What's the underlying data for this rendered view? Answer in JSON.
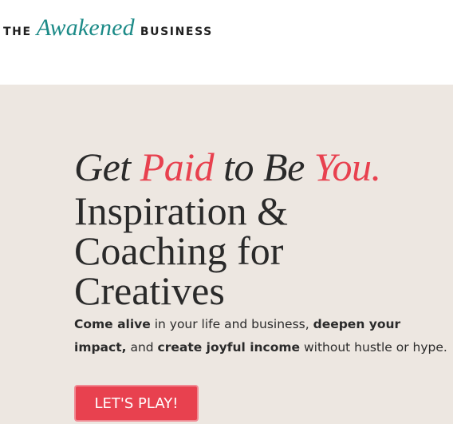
{
  "header": {
    "logo": {
      "the": "THE",
      "awakened": "Awakened",
      "business": "BUSINESS"
    }
  },
  "hero": {
    "headline": {
      "get": "Get",
      "paid": "Paid",
      "to_be": "to Be",
      "you": "You.",
      "rest": "Inspiration & Coaching for Creatives"
    },
    "subtext": {
      "part1_bold": "Come alive",
      "part2": " in your life and business, ",
      "part3_bold": "deepen your impact,",
      "part4": " and ",
      "part5_bold": "create joyful income",
      "part6": " without hustle or hype."
    },
    "cta_label": "LET'S PLAY!"
  },
  "colors": {
    "brand_teal": "#1b8a87",
    "accent_red": "#e8414f",
    "hero_background": "#ede7e1",
    "text_dark": "#2a2a2a"
  }
}
